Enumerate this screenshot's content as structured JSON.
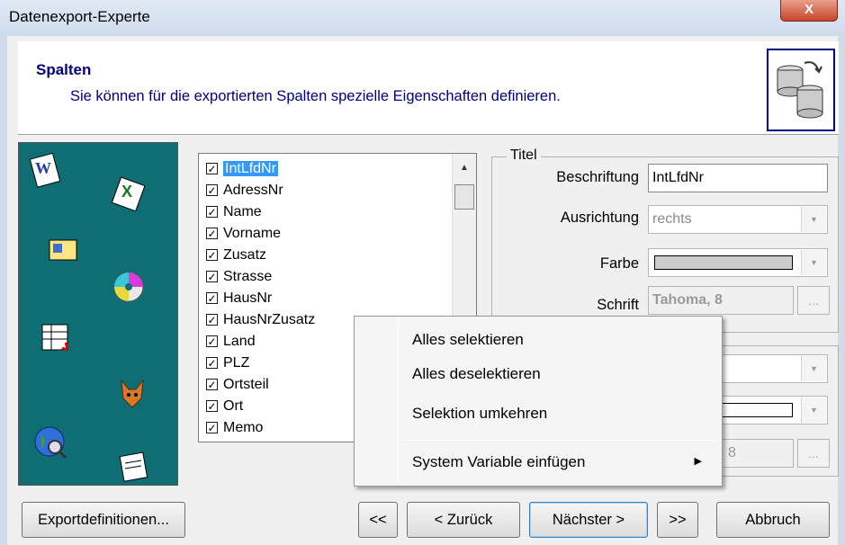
{
  "window": {
    "title": "Datenexport-Experte",
    "close_label": "X"
  },
  "header": {
    "title": "Spalten",
    "subtitle": "Sie können für die exportierten Spalten spezielle Eigenschaften definieren."
  },
  "columns": {
    "items": [
      {
        "label": "IntLfdNr",
        "checked": true,
        "selected": true
      },
      {
        "label": "AdressNr",
        "checked": true
      },
      {
        "label": "Name",
        "checked": true
      },
      {
        "label": "Vorname",
        "checked": true
      },
      {
        "label": "Zusatz",
        "checked": true
      },
      {
        "label": "Strasse",
        "checked": true
      },
      {
        "label": "HausNr",
        "checked": true
      },
      {
        "label": "HausNrZusatz",
        "checked": true
      },
      {
        "label": "Land",
        "checked": true
      },
      {
        "label": "PLZ",
        "checked": true
      },
      {
        "label": "Ortsteil",
        "checked": true
      },
      {
        "label": "Ort",
        "checked": true
      },
      {
        "label": "Memo",
        "checked": true
      }
    ],
    "check_mark": "✓"
  },
  "titel_group": {
    "legend": "Titel",
    "beschriftung_label": "Beschriftung",
    "beschriftung_value": "IntLfdNr",
    "ausrichtung_label": "Ausrichtung",
    "ausrichtung_value": "rechts",
    "farbe_label": "Farbe",
    "schrift_label": "Schrift",
    "schrift_value": "Tahoma, 8",
    "dots": "..."
  },
  "second_group": {
    "schrift_value_partial": "8",
    "dots": "..."
  },
  "context_menu": {
    "items": [
      "Alles selektieren",
      "Alles deselektieren",
      "Selektion umkehren",
      "System Variable einfügen"
    ],
    "submenu_arrow": "▶"
  },
  "buttons": {
    "exportdefinitionen": "Exportdefinitionen...",
    "first": "<<",
    "back": "< Zurück",
    "next": "Nächster >",
    "last": ">>",
    "cancel": "Abbruch"
  },
  "colors": {
    "side_panel": "#0e6e74",
    "header_text": "#000080",
    "selection": "#3399ff"
  }
}
